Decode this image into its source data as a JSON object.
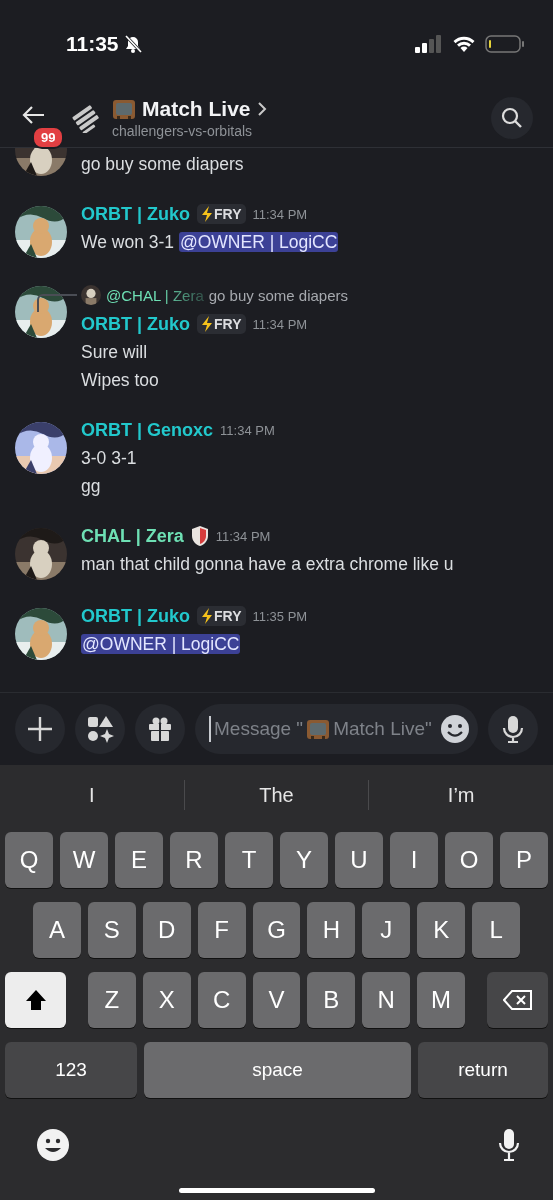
{
  "status_bar": {
    "time": "11:35"
  },
  "header": {
    "unread_badge": "99",
    "title": "Match Live",
    "subtitle": "challengers-vs-orbitals"
  },
  "messages": [
    {
      "kind": "continued",
      "lines": [
        [
          {
            "kind": "text",
            "text": "go buy some diapers"
          }
        ]
      ]
    },
    {
      "kind": "full",
      "author": "ORBT | Zuko",
      "color": "#22c8cc",
      "tag": "FRY",
      "time": "11:34 PM",
      "lines": [
        [
          {
            "kind": "text",
            "text": "We won 3-1 "
          },
          {
            "kind": "mention",
            "text": "@OWNER | LogiCC"
          }
        ]
      ]
    },
    {
      "kind": "full",
      "reply": {
        "author": "@CHAL | Zera",
        "text": "go buy some diapers"
      },
      "author": "ORBT | Zuko",
      "color": "#22c8cc",
      "tag": "FRY",
      "time": "11:34 PM",
      "lines": [
        [
          {
            "kind": "text",
            "text": "Sure will"
          }
        ],
        [
          {
            "kind": "text",
            "text": "Wipes too"
          }
        ]
      ]
    },
    {
      "kind": "full",
      "author": "ORBT | Genoxc",
      "color": "#22c8cc",
      "time": "11:34 PM",
      "lines": [
        [
          {
            "kind": "text",
            "text": "3-0 3-1"
          }
        ],
        [
          {
            "kind": "text",
            "text": "gg"
          }
        ]
      ]
    },
    {
      "kind": "full",
      "author": "CHAL | Zera",
      "color": "#6ee0b4",
      "role_icon": true,
      "time": "11:34 PM",
      "lines": [
        [
          {
            "kind": "text",
            "text": "man that child gonna have a extra chrome like u"
          }
        ]
      ]
    },
    {
      "kind": "full",
      "author": "ORBT | Zuko",
      "color": "#22c8cc",
      "tag": "FRY",
      "time": "11:35 PM",
      "lines": [
        [
          {
            "kind": "mention",
            "text": "@OWNER | LogiCC"
          }
        ]
      ]
    }
  ],
  "composer": {
    "placeholder_start": "Message \"",
    "placeholder_end": "Match Live\""
  },
  "keyboard": {
    "suggestions": [
      "I",
      "The",
      "I’m"
    ],
    "rows": [
      {
        "keys": [
          {
            "kind": "letter",
            "label": "Q"
          },
          {
            "kind": "letter",
            "label": "W"
          },
          {
            "kind": "letter",
            "label": "E"
          },
          {
            "kind": "letter",
            "label": "R"
          },
          {
            "kind": "letter",
            "label": "T"
          },
          {
            "kind": "letter",
            "label": "Y"
          },
          {
            "kind": "letter",
            "label": "U"
          },
          {
            "kind": "letter",
            "label": "I"
          },
          {
            "kind": "letter",
            "label": "O"
          },
          {
            "kind": "letter",
            "label": "P"
          }
        ]
      },
      {
        "keys": [
          {
            "kind": "letter",
            "label": "A"
          },
          {
            "kind": "letter",
            "label": "S"
          },
          {
            "kind": "letter",
            "label": "D"
          },
          {
            "kind": "letter",
            "label": "F"
          },
          {
            "kind": "letter",
            "label": "G"
          },
          {
            "kind": "letter",
            "label": "H"
          },
          {
            "kind": "letter",
            "label": "J"
          },
          {
            "kind": "letter",
            "label": "K"
          },
          {
            "kind": "letter",
            "label": "L"
          }
        ]
      },
      {
        "keys": [
          {
            "kind": "shift",
            "on": true
          },
          {
            "kind": "letter",
            "label": "Z"
          },
          {
            "kind": "letter",
            "label": "X"
          },
          {
            "kind": "letter",
            "label": "C"
          },
          {
            "kind": "letter",
            "label": "V"
          },
          {
            "kind": "letter",
            "label": "B"
          },
          {
            "kind": "letter",
            "label": "N"
          },
          {
            "kind": "letter",
            "label": "M"
          },
          {
            "kind": "delete"
          }
        ]
      },
      {
        "keys": [
          {
            "kind": "mode",
            "label": "123"
          },
          {
            "kind": "space",
            "label": "space"
          },
          {
            "kind": "return",
            "label": "return"
          }
        ]
      }
    ]
  }
}
